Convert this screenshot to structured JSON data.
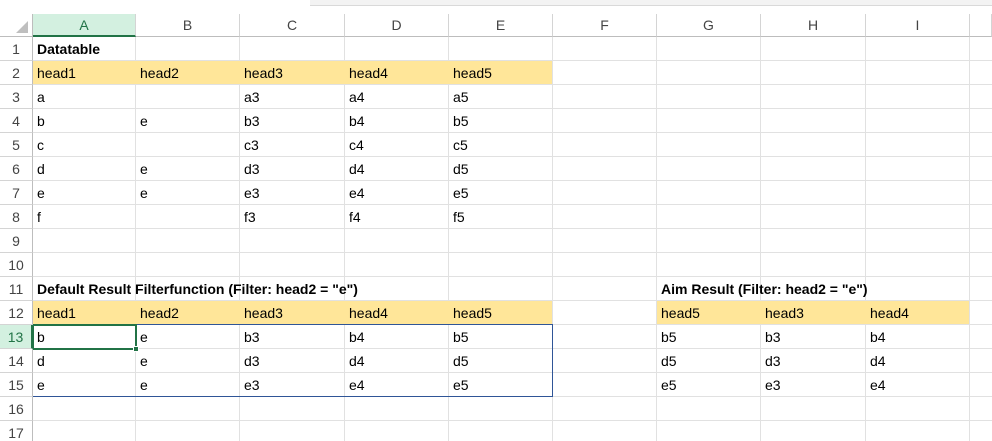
{
  "columns": [
    "A",
    "B",
    "C",
    "D",
    "E",
    "F",
    "G",
    "H",
    "I"
  ],
  "rows": [
    "1",
    "2",
    "3",
    "4",
    "5",
    "6",
    "7",
    "8",
    "9",
    "10",
    "11",
    "12",
    "13",
    "14",
    "15",
    "16",
    "17"
  ],
  "selected_column": "A",
  "selected_row": "13",
  "header_fill_color": "#ffe699",
  "range_border_color": "#2f5597",
  "cells": [
    {
      "ref": "A1",
      "text": "Datatable",
      "bold": true
    },
    {
      "ref": "A2",
      "text": "head1"
    },
    {
      "ref": "B2",
      "text": "head2"
    },
    {
      "ref": "C2",
      "text": "head3"
    },
    {
      "ref": "D2",
      "text": "head4"
    },
    {
      "ref": "E2",
      "text": "head5"
    },
    {
      "ref": "A3",
      "text": "a"
    },
    {
      "ref": "C3",
      "text": "a3"
    },
    {
      "ref": "D3",
      "text": "a4"
    },
    {
      "ref": "E3",
      "text": "a5"
    },
    {
      "ref": "A4",
      "text": "b"
    },
    {
      "ref": "B4",
      "text": "e"
    },
    {
      "ref": "C4",
      "text": "b3"
    },
    {
      "ref": "D4",
      "text": "b4"
    },
    {
      "ref": "E4",
      "text": "b5"
    },
    {
      "ref": "A5",
      "text": "c"
    },
    {
      "ref": "C5",
      "text": "c3"
    },
    {
      "ref": "D5",
      "text": "c4"
    },
    {
      "ref": "E5",
      "text": "c5"
    },
    {
      "ref": "A6",
      "text": "d"
    },
    {
      "ref": "B6",
      "text": "e"
    },
    {
      "ref": "C6",
      "text": "d3"
    },
    {
      "ref": "D6",
      "text": "d4"
    },
    {
      "ref": "E6",
      "text": "d5"
    },
    {
      "ref": "A7",
      "text": "e"
    },
    {
      "ref": "B7",
      "text": "e"
    },
    {
      "ref": "C7",
      "text": "e3"
    },
    {
      "ref": "D7",
      "text": "e4"
    },
    {
      "ref": "E7",
      "text": "e5"
    },
    {
      "ref": "A8",
      "text": "f"
    },
    {
      "ref": "C8",
      "text": "f3"
    },
    {
      "ref": "D8",
      "text": "f4"
    },
    {
      "ref": "E8",
      "text": "f5"
    },
    {
      "ref": "A11",
      "text": "Default Result Filterfunction (Filter: head2 = \"e\")",
      "bold": true
    },
    {
      "ref": "G11",
      "text": "Aim Result   (Filter: head2 = \"e\")",
      "bold": true
    },
    {
      "ref": "A12",
      "text": "head1"
    },
    {
      "ref": "B12",
      "text": "head2"
    },
    {
      "ref": "C12",
      "text": "head3"
    },
    {
      "ref": "D12",
      "text": "head4"
    },
    {
      "ref": "E12",
      "text": "head5"
    },
    {
      "ref": "G12",
      "text": "head5"
    },
    {
      "ref": "H12",
      "text": "head3"
    },
    {
      "ref": "I12",
      "text": "head4"
    },
    {
      "ref": "A13",
      "text": "b"
    },
    {
      "ref": "B13",
      "text": "e"
    },
    {
      "ref": "C13",
      "text": "b3"
    },
    {
      "ref": "D13",
      "text": "b4"
    },
    {
      "ref": "E13",
      "text": "b5"
    },
    {
      "ref": "G13",
      "text": "b5"
    },
    {
      "ref": "H13",
      "text": "b3"
    },
    {
      "ref": "I13",
      "text": "b4"
    },
    {
      "ref": "A14",
      "text": "d"
    },
    {
      "ref": "B14",
      "text": "e"
    },
    {
      "ref": "C14",
      "text": "d3"
    },
    {
      "ref": "D14",
      "text": "d4"
    },
    {
      "ref": "E14",
      "text": "d5"
    },
    {
      "ref": "G14",
      "text": "d5"
    },
    {
      "ref": "H14",
      "text": "d3"
    },
    {
      "ref": "I14",
      "text": "d4"
    },
    {
      "ref": "A15",
      "text": "e"
    },
    {
      "ref": "B15",
      "text": "e"
    },
    {
      "ref": "C15",
      "text": "e3"
    },
    {
      "ref": "D15",
      "text": "e4"
    },
    {
      "ref": "E15",
      "text": "e5"
    },
    {
      "ref": "G15",
      "text": "e5"
    },
    {
      "ref": "H15",
      "text": "e3"
    },
    {
      "ref": "I15",
      "text": "e4"
    }
  ],
  "highlight_ranges": [
    "A2:E2",
    "A12:E12",
    "G12:I12"
  ],
  "bordered_range": "A13:E15",
  "active_cell": "A13"
}
